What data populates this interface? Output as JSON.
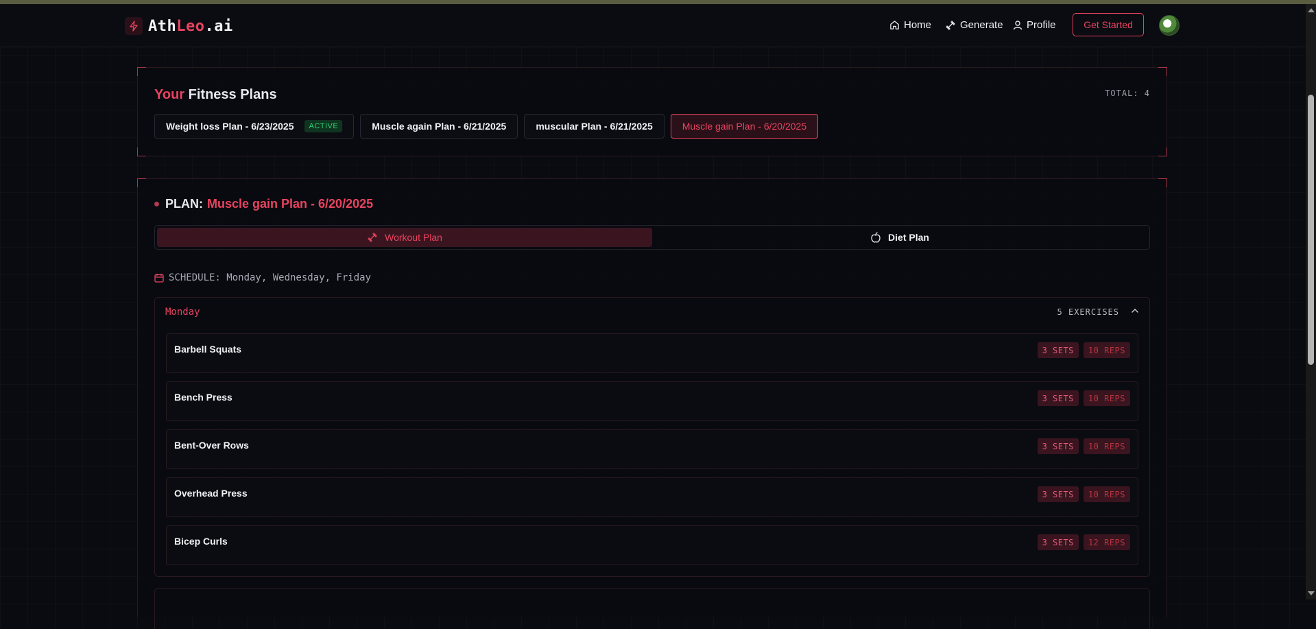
{
  "brand": {
    "prefix": "Ath",
    "accent": "Leo",
    "suffix": ".ai",
    "accent_color": "#e8435f"
  },
  "nav": {
    "home": "Home",
    "generate": "Generate",
    "profile": "Profile",
    "get_started": "Get Started"
  },
  "plans_panel": {
    "title_accent": "Your",
    "title_rest": "Fitness Plans",
    "total": "TOTAL: 4",
    "plans": [
      {
        "label": "Weight loss Plan - 6/23/2025",
        "badge": "ACTIVE"
      },
      {
        "label": "Muscle again Plan - 6/21/2025"
      },
      {
        "label": "muscular Plan - 6/21/2025"
      },
      {
        "label": "Muscle gain Plan - 6/20/2025"
      }
    ]
  },
  "plan_detail": {
    "prefix": "PLAN:",
    "name": "Muscle gain Plan - 6/20/2025",
    "tabs": {
      "workout": "Workout Plan",
      "diet": "Diet Plan"
    },
    "schedule": "SCHEDULE: Monday, Wednesday, Friday",
    "day": {
      "name": "Monday",
      "count": "5 EXERCISES",
      "exercises": [
        {
          "name": "Barbell Squats",
          "sets": "3 SETS",
          "reps": "10 REPS"
        },
        {
          "name": "Bench Press",
          "sets": "3 SETS",
          "reps": "10 REPS"
        },
        {
          "name": "Bent-Over Rows",
          "sets": "3 SETS",
          "reps": "10 REPS"
        },
        {
          "name": "Overhead Press",
          "sets": "3 SETS",
          "reps": "10 REPS"
        },
        {
          "name": "Bicep Curls",
          "sets": "3 SETS",
          "reps": "12 REPS"
        }
      ]
    }
  },
  "icons": {
    "logo": "lightning-icon",
    "home": "home-icon",
    "generate": "dumbbell-icon",
    "profile": "user-icon",
    "diet": "apple-icon",
    "schedule": "calendar-icon",
    "collapse": "chevron-up-icon"
  }
}
